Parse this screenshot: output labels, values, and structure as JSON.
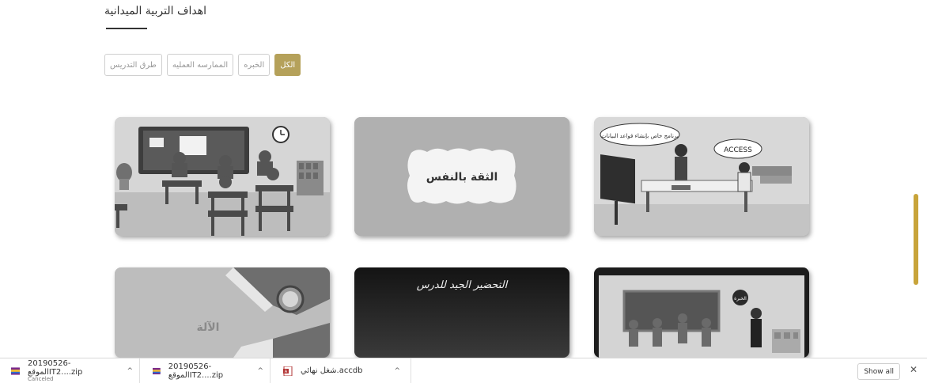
{
  "page": {
    "title": "اهداف التربية الميدانية"
  },
  "filters": [
    {
      "label": "طرق التدريس",
      "active": false
    },
    {
      "label": "الممارسه العمليه",
      "active": false
    },
    {
      "label": "الخبره",
      "active": false
    },
    {
      "label": "الكل",
      "active": true
    }
  ],
  "colors": {
    "accent": "#b5a15a",
    "scrollbar": "#c8a43a"
  },
  "cards": {
    "card1_text": "",
    "card2_text": "الثقة بالنفس",
    "card3_bubble": "برنامج خاص بإنشاء قواعد البيانات",
    "card3_label": "ACCESS",
    "card5_text": "التحضير الجيد للدرس",
    "card4_text": "الآلة",
    "card6_bubble": "الخبرة"
  },
  "downloads": [
    {
      "name": "20190526-الموقعIT2....zip",
      "status": "Canceled",
      "icon": "archive-icon"
    },
    {
      "name": "20190526-الموقعIT2....zip",
      "status": "",
      "icon": "archive-icon"
    },
    {
      "name": "شغل نهائي.accdb",
      "status": "",
      "icon": "access-file-icon"
    }
  ],
  "download_bar": {
    "show_all": "Show all",
    "close": "✕"
  }
}
